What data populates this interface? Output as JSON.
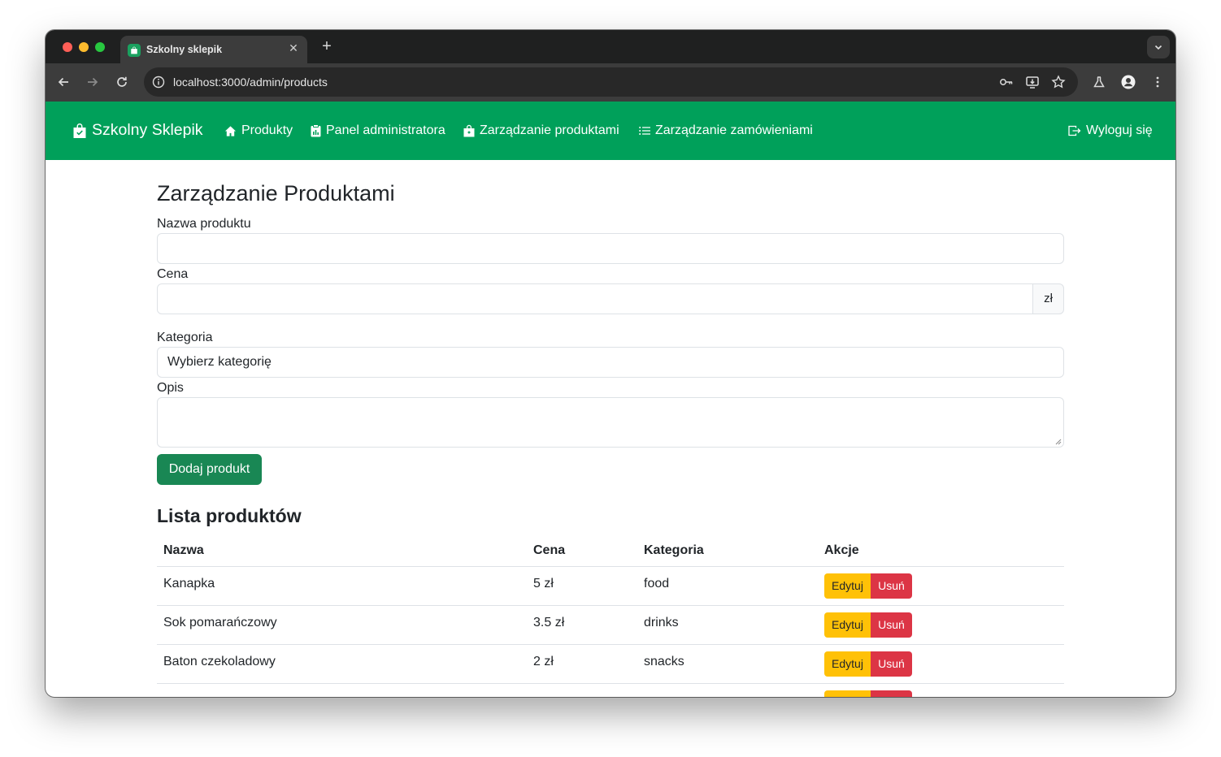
{
  "browser": {
    "tab_title": "Szkolny sklepik",
    "tab_close": "✕",
    "new_tab": "+",
    "url": "localhost:3000/admin/products"
  },
  "navbar": {
    "brand": "Szkolny Sklepik",
    "links": [
      {
        "label": "Produkty",
        "icon": "house-icon"
      },
      {
        "label": "Panel administratora",
        "icon": "clipboard-chart-icon"
      },
      {
        "label": "Zarządzanie produktami",
        "icon": "shopping-bag-icon"
      },
      {
        "label": "Zarządzanie zamówieniami",
        "icon": "list-icon"
      }
    ],
    "logout": "Wyloguj się",
    "color": "#00a05a"
  },
  "form": {
    "title": "Zarządzanie Produktami",
    "name_label": "Nazwa produktu",
    "name_value": "",
    "price_label": "Cena",
    "price_value": "",
    "currency": "zł",
    "category_label": "Kategoria",
    "category_selected": "Wybierz kategorię",
    "description_label": "Opis",
    "description_value": "",
    "submit_label": "Dodaj produkt"
  },
  "products": {
    "title": "Lista produktów",
    "headers": [
      "Nazwa",
      "Cena",
      "Kategoria",
      "Akcje"
    ],
    "edit_label": "Edytuj",
    "delete_label": "Usuń",
    "rows": [
      {
        "name": "Kanapka",
        "price": "5 zł",
        "category": "food"
      },
      {
        "name": "Sok pomarańczowy",
        "price": "3.5 zł",
        "category": "drinks"
      },
      {
        "name": "Baton czekoladowy",
        "price": "2 zł",
        "category": "snacks"
      }
    ]
  },
  "colors": {
    "success": "#198754",
    "warning": "#ffc107",
    "danger": "#dc3545"
  }
}
